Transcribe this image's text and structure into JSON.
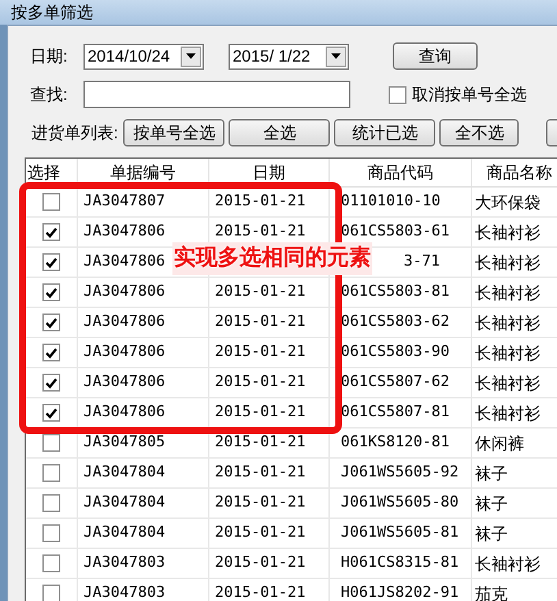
{
  "window": {
    "title": "按多单筛选"
  },
  "date_from": "2014/10/24",
  "date_to": "2015/ 1/22",
  "query_button": "查询",
  "search": {
    "label": "查找:"
  },
  "date_label": "日期:",
  "cancel_select": {
    "label": "取消按单号全选",
    "checked": false
  },
  "list_label": "进货单列表:",
  "buttons": [
    "按单号全选",
    "全选",
    "统计已选",
    "全不选"
  ],
  "table": {
    "columns": [
      "选择",
      "单据编号",
      "日期",
      "商品代码",
      "商品名称"
    ],
    "rows": [
      {
        "checked": false,
        "number": "JA3047807",
        "date": "2015-01-21",
        "code": "01101010-10",
        "name": "大环保袋"
      },
      {
        "checked": true,
        "number": "JA3047806",
        "date": "2015-01-21",
        "code": "061CS5803-61",
        "name": "长袖衬衫"
      },
      {
        "checked": true,
        "number": "JA3047806",
        "code": "3-71",
        "name": "长袖衬衫",
        "covered": true
      },
      {
        "checked": true,
        "number": "JA3047806",
        "date": "2015-01-21",
        "code": "061CS5803-81",
        "name": "长袖衬衫"
      },
      {
        "checked": true,
        "number": "JA3047806",
        "date": "2015-01-21",
        "code": "061CS5803-62",
        "name": "长袖衬衫"
      },
      {
        "checked": true,
        "number": "JA3047806",
        "date": "2015-01-21",
        "code": "061CS5803-90",
        "name": "长袖衬衫"
      },
      {
        "checked": true,
        "number": "JA3047806",
        "date": "2015-01-21",
        "code": "061CS5807-62",
        "name": "长袖衬衫"
      },
      {
        "checked": true,
        "number": "JA3047806",
        "date": "2015-01-21",
        "code": "061CS5807-81",
        "name": "长袖衬衫"
      },
      {
        "checked": false,
        "number": "JA3047805",
        "date": "2015-01-21",
        "code": "061KS8120-81",
        "name": "休闲裤"
      },
      {
        "checked": false,
        "number": "JA3047804",
        "date": "2015-01-21",
        "code": "J061WS5605-92",
        "name": "袜子"
      },
      {
        "checked": false,
        "number": "JA3047804",
        "date": "2015-01-21",
        "code": "J061WS5605-80",
        "name": "袜子"
      },
      {
        "checked": false,
        "number": "JA3047804",
        "date": "2015-01-21",
        "code": "J061WS5605-81",
        "name": "袜子"
      },
      {
        "checked": false,
        "number": "JA3047803",
        "date": "2015-01-21",
        "code": "H061CS8315-81",
        "name": "长袖衬衫"
      },
      {
        "checked": false,
        "number": "JA3047803",
        "date": "2015-01-21",
        "code": "H061JS8202-91",
        "name": "茄克"
      }
    ]
  },
  "annotation": {
    "label": "实现多选相同的元素"
  }
}
